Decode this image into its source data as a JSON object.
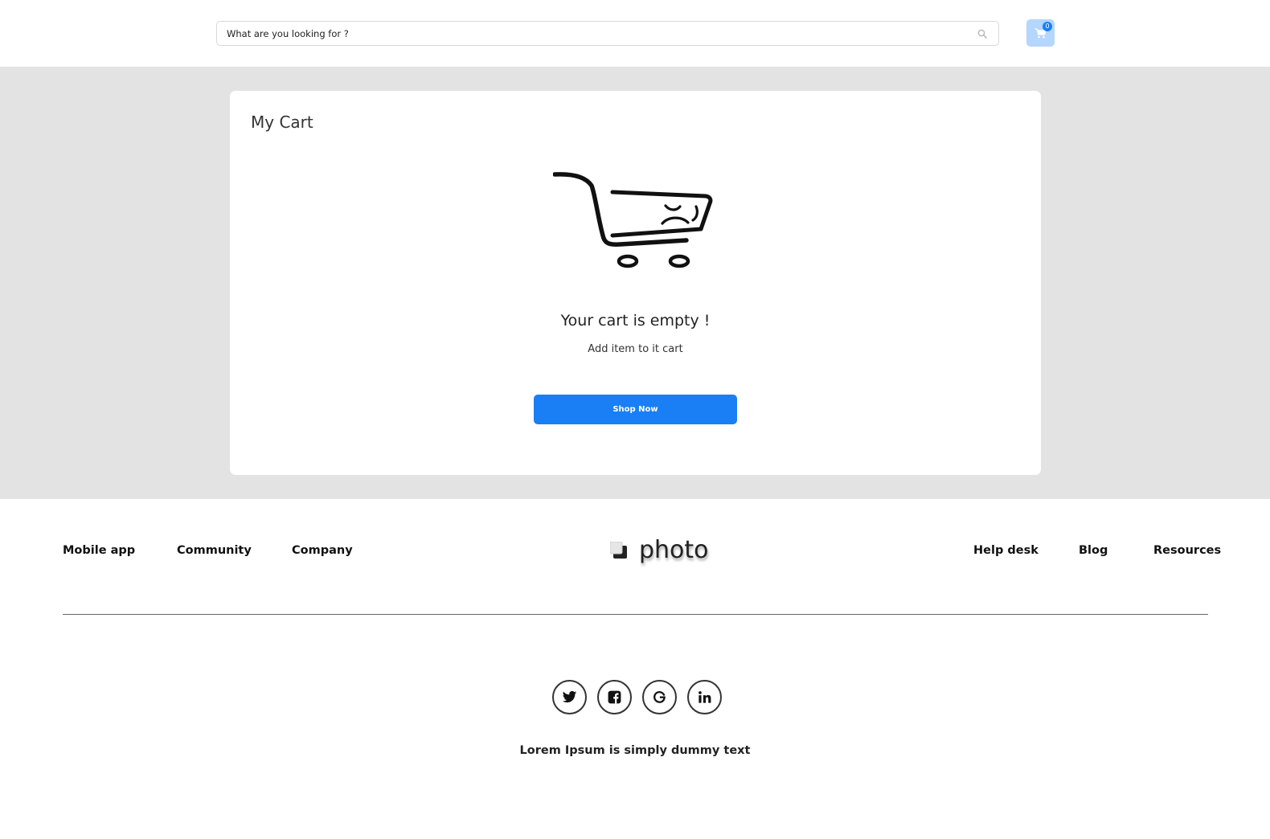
{
  "header": {
    "search": {
      "placeholder": "What are you looking for ?",
      "value": "",
      "icon": "search-icon"
    },
    "cart": {
      "icon": "cart-icon",
      "count": "0",
      "accent": "#b4d6ff",
      "badge_color": "#1a7ff5"
    }
  },
  "main": {
    "background": "#e3e3e3",
    "card": {
      "title": "My Cart",
      "illustration": "sad-cart-icon",
      "empty_title": "Your cart is empty !",
      "empty_subtitle": "Add item to it cart",
      "shop_button": "Shop Now",
      "button_color": "#1a7ff5"
    }
  },
  "footer": {
    "left_links": [
      "Mobile app",
      "Community",
      "Company"
    ],
    "logo": {
      "text": "photo",
      "icon": "logo-mark-icon"
    },
    "right_links": [
      "Help desk",
      "Blog",
      "Resources"
    ],
    "social": [
      {
        "name": "twitter",
        "icon": "twitter-icon"
      },
      {
        "name": "facebook",
        "icon": "facebook-icon"
      },
      {
        "name": "google",
        "icon": "google-icon"
      },
      {
        "name": "linkedin",
        "icon": "linkedin-icon"
      }
    ],
    "tagline": "Lorem Ipsum is simply dummy text"
  }
}
